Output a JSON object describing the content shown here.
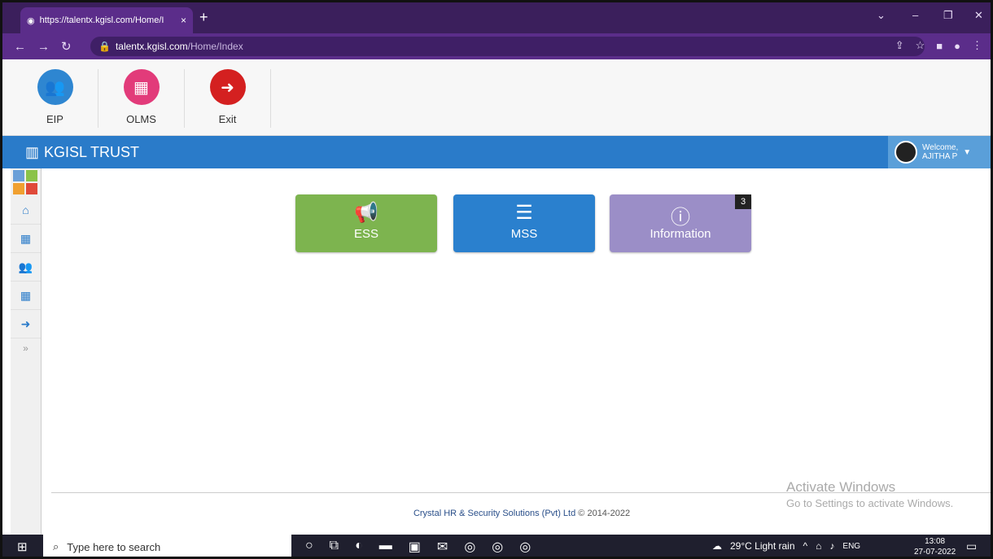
{
  "browser": {
    "tab_title": "https://talentx.kgisl.com/Home/I",
    "tab_close": "×",
    "new_tab": "+",
    "url_host": "talentx.kgisl.com",
    "url_path": "/Home/Index",
    "window_controls": [
      "⌄",
      "–",
      "❐",
      "✕"
    ]
  },
  "appbar": {
    "buttons": [
      {
        "label": "EIP",
        "color": "#2e86d1",
        "icon": "users-icon"
      },
      {
        "label": "OLMS",
        "color": "#e23b7a",
        "icon": "calendar-icon"
      },
      {
        "label": "Exit",
        "color": "#d42020",
        "icon": "sign-out-icon"
      }
    ]
  },
  "header": {
    "title": "KGISL TRUST",
    "welcome": "Welcome,",
    "user_name": "AJITHA P"
  },
  "sidebar": {
    "items": [
      "home-icon",
      "calendar-icon",
      "users-icon",
      "calendar-icon",
      "sign-out-icon"
    ]
  },
  "cards": [
    {
      "label": "ESS",
      "color": "#7db44f",
      "icon": "megaphone-icon"
    },
    {
      "label": "MSS",
      "color": "#2a80ce",
      "icon": "server-icon"
    },
    {
      "label": "Information",
      "color": "#9b8ec7",
      "icon": "info-icon",
      "badge": "3"
    }
  ],
  "footer": {
    "company": "Crystal HR & Security Solutions (Pvt) Ltd",
    "copyright": "© 2014-2022"
  },
  "watermark": {
    "line1": "Activate Windows",
    "line2": "Go to Settings to activate Windows."
  },
  "taskbar": {
    "search_placeholder": "Type here to search",
    "weather": "29°C  Light rain",
    "lang": "ENG",
    "time": "13:08",
    "date": "27-07-2022"
  }
}
